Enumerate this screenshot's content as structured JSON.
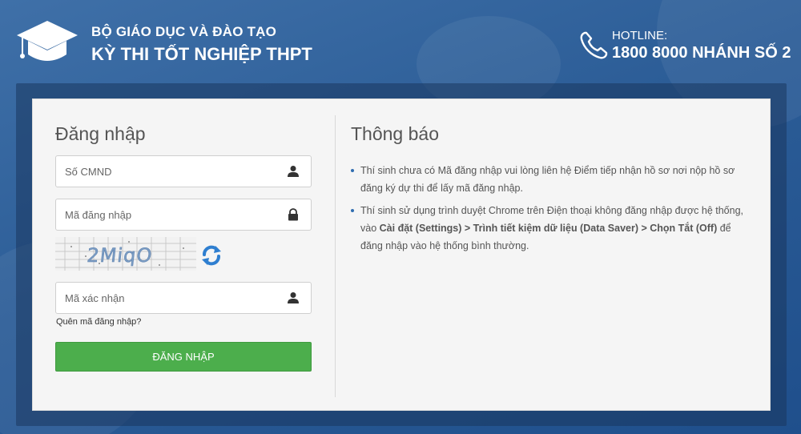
{
  "header": {
    "org_line1": "BỘ GIÁO DỤC VÀ ĐÀO TẠO",
    "org_line2": "KỲ THI TỐT NGHIỆP THPT",
    "logo_icon": "graduation-cap-icon",
    "hotline_icon": "phone-icon",
    "hotline_label": "HOTLINE:",
    "hotline_number": "1800 8000 NHÁNH SỐ 2"
  },
  "login": {
    "title": "Đăng nhập",
    "id_field": {
      "placeholder": "Số CMND",
      "icon": "user-icon",
      "value": ""
    },
    "code_field": {
      "placeholder": "Mã đăng nhập",
      "icon": "lock-icon",
      "value": ""
    },
    "captcha": {
      "text": "2MiqO",
      "refresh_icon": "refresh-icon"
    },
    "verify_field": {
      "placeholder": "Mã xác nhận",
      "icon": "user-icon",
      "value": ""
    },
    "forgot_link": "Quên mã đăng nhập?",
    "submit_label": "ĐĂNG NHẬP"
  },
  "notice": {
    "title": "Thông báo",
    "items": [
      {
        "text": "Thí sinh chưa có Mã đăng nhập vui lòng liên hệ Điểm tiếp nhận hồ sơ nơi nộp hồ sơ đăng ký dự thi để lấy mã đăng nhập."
      },
      {
        "pre": "Thí sinh sử dụng trình duyệt Chrome trên Điện thoại không đăng nhập được hệ thống, vào ",
        "bold": "Cài đặt (Settings) > Trình tiết kiệm dữ liệu (Data Saver) > Chọn Tắt (Off)",
        "post": " để đăng nhập vào hệ thống bình thường."
      }
    ]
  },
  "colors": {
    "background": "#2c5d97",
    "button": "#4cae4c",
    "panel": "#f5f5f5"
  }
}
